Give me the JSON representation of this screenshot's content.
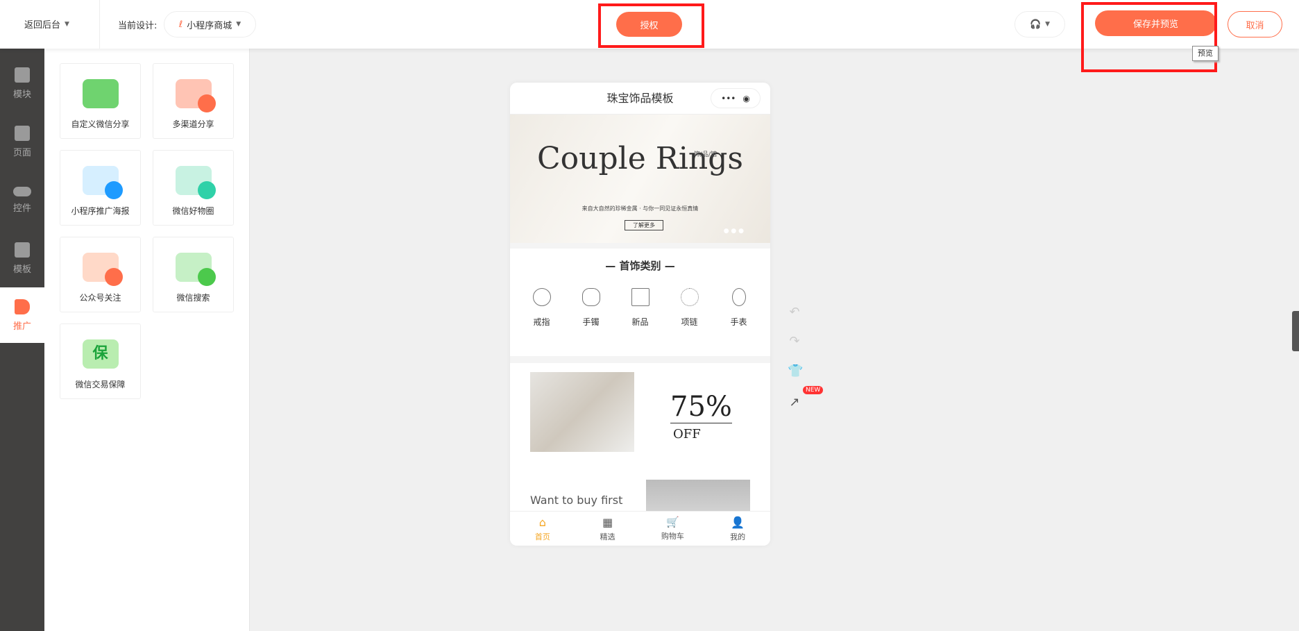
{
  "header": {
    "back_label": "返回后台",
    "design_label": "当前设计:",
    "design_value": "小程序商城",
    "authorize_label": "授权",
    "save_preview_label": "保存并预览",
    "cancel_label": "取消",
    "tooltip": "预览"
  },
  "sidebar": {
    "items": [
      {
        "label": "模块",
        "icon": "modules-icon"
      },
      {
        "label": "页面",
        "icon": "page-icon"
      },
      {
        "label": "控件",
        "icon": "toggle-icon"
      },
      {
        "label": "模板",
        "icon": "template-icon"
      },
      {
        "label": "推广",
        "icon": "megaphone-icon",
        "active": true
      }
    ]
  },
  "panel": {
    "cards": [
      {
        "label": "自定义微信分享"
      },
      {
        "label": "多渠道分享"
      },
      {
        "label": "小程序推广海报"
      },
      {
        "label": "微信好物圈"
      },
      {
        "label": "公众号关注"
      },
      {
        "label": "微信搜索"
      },
      {
        "label": "微信交易保障",
        "badge": "保"
      }
    ]
  },
  "phone": {
    "title": "珠宝饰品模板",
    "banner": {
      "headline": "Couple Rings",
      "tag": "饰/品/馆",
      "subtitle": "来自大自然的珍稀金属 · 与你一同见证永恒真情",
      "button": "了解更多"
    },
    "category_title": "首饰类别",
    "categories": [
      {
        "label": "戒指"
      },
      {
        "label": "手镯"
      },
      {
        "label": "新品"
      },
      {
        "label": "项链"
      },
      {
        "label": "手表"
      }
    ],
    "promo": {
      "percent": "75%",
      "off": "OFF",
      "text": "Want to buy first"
    },
    "tabs": [
      {
        "label": "首页",
        "active": true
      },
      {
        "label": "精选"
      },
      {
        "label": "购物车"
      },
      {
        "label": "我的"
      }
    ]
  },
  "tools": {
    "new_badge": "NEW"
  },
  "colors": {
    "accent": "#ff6e4a",
    "highlight": "#ff1a1a",
    "tab_active": "#f5a623"
  }
}
